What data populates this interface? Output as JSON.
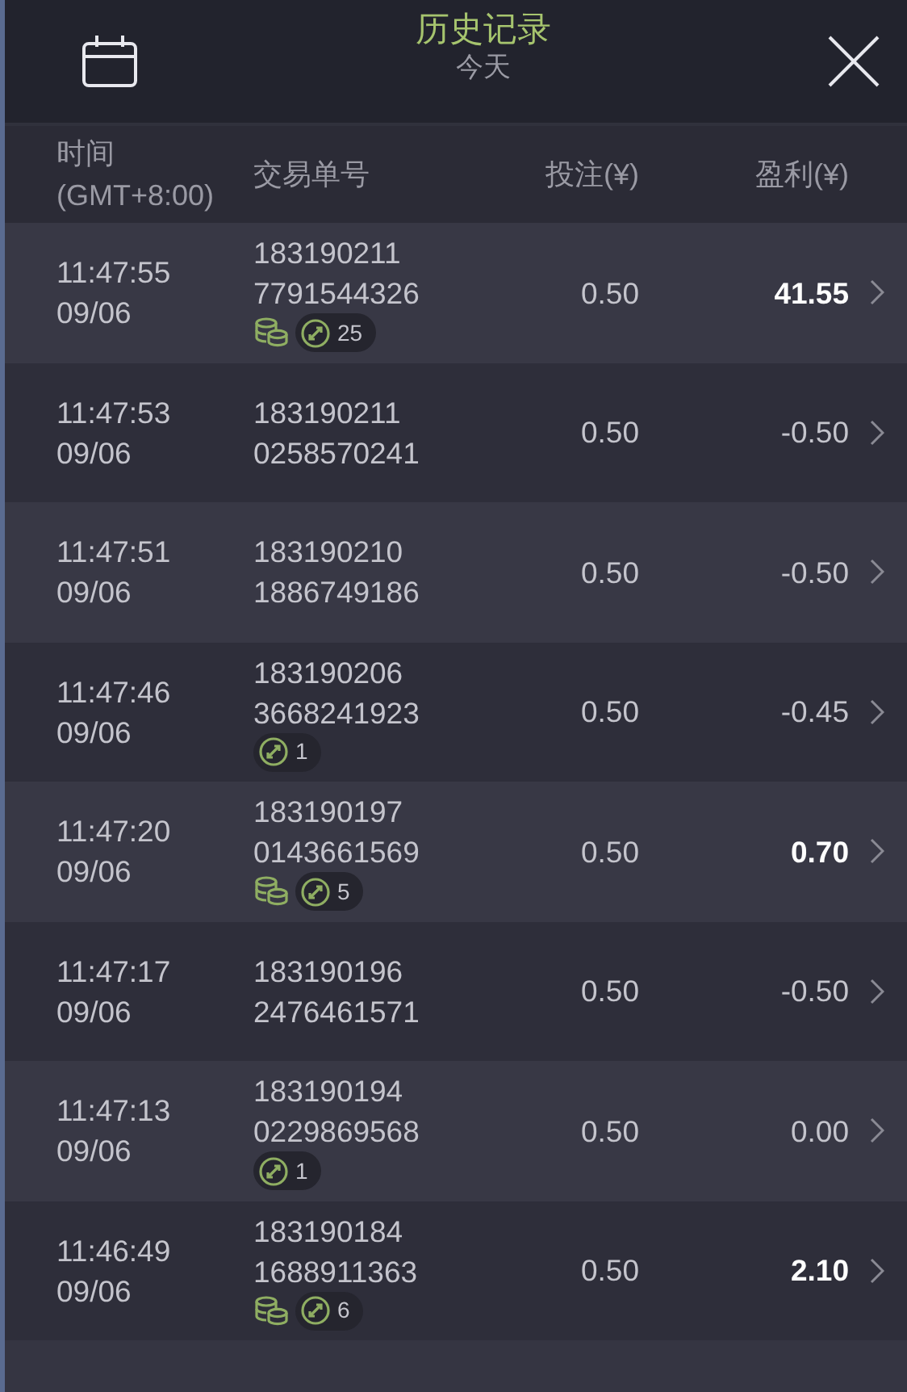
{
  "header": {
    "title": "历史记录",
    "subtitle": "今天"
  },
  "columns": [
    {
      "label": "时间",
      "sublabel": "(GMT+8:00)"
    },
    {
      "label": "交易单号"
    },
    {
      "label": "投注(¥)"
    },
    {
      "label": "盈利(¥)"
    }
  ],
  "rows": [
    {
      "time": "11:47:55",
      "date": "09/06",
      "order_1": "183190211",
      "order_2": "7791544326",
      "coins": true,
      "count": "25",
      "stake": "0.50",
      "profit": "41.55",
      "win": true
    },
    {
      "time": "11:47:53",
      "date": "09/06",
      "order_1": "183190211",
      "order_2": "0258570241",
      "coins": false,
      "stake": "0.50",
      "profit": "-0.50",
      "win": false
    },
    {
      "time": "11:47:51",
      "date": "09/06",
      "order_1": "183190210",
      "order_2": "1886749186",
      "coins": false,
      "stake": "0.50",
      "profit": "-0.50",
      "win": false
    },
    {
      "time": "11:47:46",
      "date": "09/06",
      "order_1": "183190206",
      "order_2": "3668241923",
      "coins": false,
      "count": "1",
      "stake": "0.50",
      "profit": "-0.45",
      "win": false
    },
    {
      "time": "11:47:20",
      "date": "09/06",
      "order_1": "183190197",
      "order_2": "0143661569",
      "coins": true,
      "count": "5",
      "stake": "0.50",
      "profit": "0.70",
      "win": true
    },
    {
      "time": "11:47:17",
      "date": "09/06",
      "order_1": "183190196",
      "order_2": "2476461571",
      "coins": false,
      "stake": "0.50",
      "profit": "-0.50",
      "win": false
    },
    {
      "time": "11:47:13",
      "date": "09/06",
      "order_1": "183190194",
      "order_2": "0229869568",
      "coins": false,
      "count": "1",
      "stake": "0.50",
      "profit": "0.00",
      "win": false
    },
    {
      "time": "11:46:49",
      "date": "09/06",
      "order_1": "183190184",
      "order_2": "1688911363",
      "coins": true,
      "count": "6",
      "stake": "0.50",
      "profit": "2.10",
      "win": true
    }
  ]
}
